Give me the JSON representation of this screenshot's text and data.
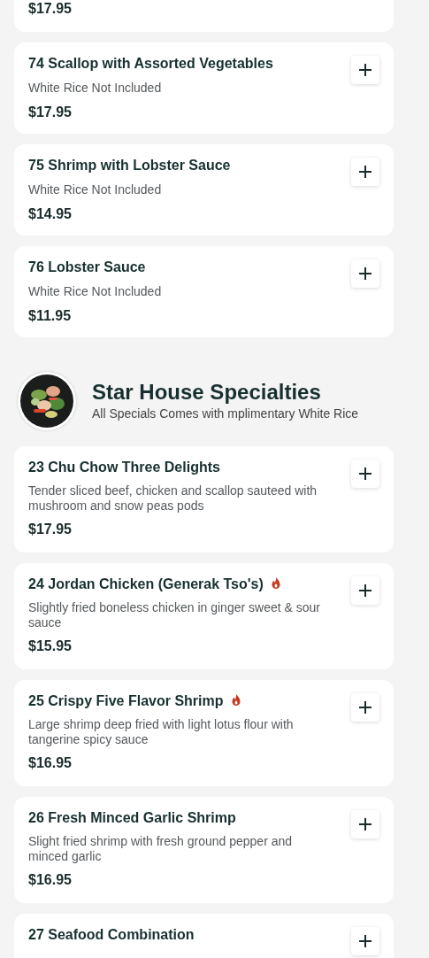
{
  "sections": [
    {
      "items": [
        {
          "price": "$17.95",
          "partial": true
        },
        {
          "name": "74 Scallop with Assorted Vegetables",
          "spicy": false,
          "description": "White Rice Not Included",
          "price": "$17.95"
        },
        {
          "name": "75 Shrimp with Lobster Sauce",
          "spicy": false,
          "description": "White Rice Not Included",
          "price": "$14.95"
        },
        {
          "name": "76 Lobster Sauce",
          "spicy": false,
          "description": "White Rice Not Included",
          "price": "$11.95"
        }
      ]
    },
    {
      "title": "Star House Specialties",
      "subtitle": "All Specials Comes with mplimentary White Rice",
      "items": [
        {
          "name": "23 Chu Chow Three Delights",
          "spicy": false,
          "description": "Tender sliced beef, chicken and scallop sauteed with mushroom and snow peas pods",
          "price": "$17.95"
        },
        {
          "name": "24 Jordan Chicken (Generak Tso's)",
          "spicy": true,
          "description": "Slightly fried boneless chicken in ginger sweet & sour sauce",
          "price": "$15.95"
        },
        {
          "name": "25 Crispy Five Flavor Shrimp",
          "spicy": true,
          "description": "Large shrimp deep fried with light lotus flour with tangerine spicy sauce",
          "price": "$16.95"
        },
        {
          "name": "26 Fresh Minced Garlic Shrimp",
          "spicy": false,
          "description": "Slight fried shrimp with fresh ground pepper and minced garlic",
          "price": "$16.95"
        },
        {
          "name": "27 Seafood Combination",
          "spicy": false
        }
      ]
    }
  ]
}
